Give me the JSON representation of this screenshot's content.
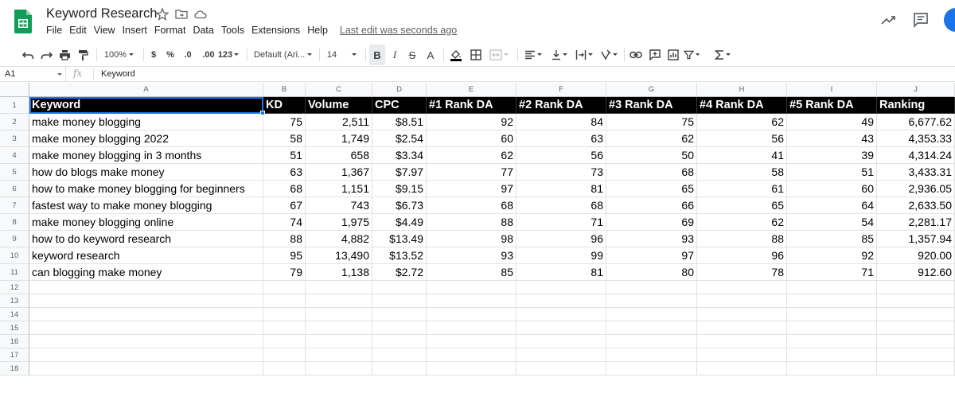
{
  "app": {
    "title": "Keyword Research",
    "last_edit": "Last edit was seconds ago",
    "menu": [
      "File",
      "Edit",
      "View",
      "Insert",
      "Format",
      "Data",
      "Tools",
      "Extensions",
      "Help"
    ]
  },
  "toolbar": {
    "zoom": "100%",
    "currency": "$",
    "percent": "%",
    "decrease_decimal": ".0",
    "increase_decimal": ".00",
    "more_formats": "123",
    "font": "Default (Ari...",
    "font_size": "14",
    "bold": "B",
    "italic": "I",
    "strikethrough": "S",
    "text_color": "A"
  },
  "formula_bar": {
    "cell_ref": "A1",
    "fx": "fx",
    "value": "Keyword"
  },
  "columns": [
    "A",
    "B",
    "C",
    "D",
    "E",
    "F",
    "G",
    "H",
    "I",
    "J"
  ],
  "rows": [
    "1",
    "2",
    "3",
    "4",
    "5",
    "6",
    "7",
    "8",
    "9",
    "10",
    "11",
    "12",
    "13",
    "14",
    "15",
    "16",
    "17",
    "18"
  ],
  "table": {
    "headers": [
      "Keyword",
      "KD",
      "Volume",
      "CPC",
      "#1 Rank DA",
      "#2 Rank DA",
      "#3 Rank DA",
      "#4 Rank DA",
      "#5 Rank DA",
      "Ranking"
    ],
    "rows": [
      [
        "make money blogging",
        "75",
        "2,511",
        "$8.51",
        "92",
        "84",
        "75",
        "62",
        "49",
        "6,677.62"
      ],
      [
        "make money blogging 2022",
        "58",
        "1,749",
        "$2.54",
        "60",
        "63",
        "62",
        "56",
        "43",
        "4,353.33"
      ],
      [
        "make money blogging in 3 months",
        "51",
        "658",
        "$3.34",
        "62",
        "56",
        "50",
        "41",
        "39",
        "4,314.24"
      ],
      [
        "how do blogs make money",
        "63",
        "1,367",
        "$7.97",
        "77",
        "73",
        "68",
        "58",
        "51",
        "3,433.31"
      ],
      [
        "how to make money blogging for beginners",
        "68",
        "1,151",
        "$9.15",
        "97",
        "81",
        "65",
        "61",
        "60",
        "2,936.05"
      ],
      [
        "fastest way to make money blogging",
        "67",
        "743",
        "$6.73",
        "68",
        "68",
        "66",
        "65",
        "64",
        "2,633.50"
      ],
      [
        "make money blogging online",
        "74",
        "1,975",
        "$4.49",
        "88",
        "71",
        "69",
        "62",
        "54",
        "2,281.17"
      ],
      [
        "how to do keyword research",
        "88",
        "4,882",
        "$13.49",
        "98",
        "96",
        "93",
        "88",
        "85",
        "1,357.94"
      ],
      [
        "keyword research",
        "95",
        "13,490",
        "$13.52",
        "93",
        "99",
        "97",
        "96",
        "92",
        "920.00"
      ],
      [
        "can blogging make money",
        "79",
        "1,138",
        "$2.72",
        "85",
        "81",
        "80",
        "78",
        "71",
        "912.60"
      ]
    ]
  },
  "colors": {
    "header_bg": "#000000",
    "header_text": "#ffffff",
    "selection": "#1a73e8",
    "sheets_green": "#0f9d58"
  }
}
